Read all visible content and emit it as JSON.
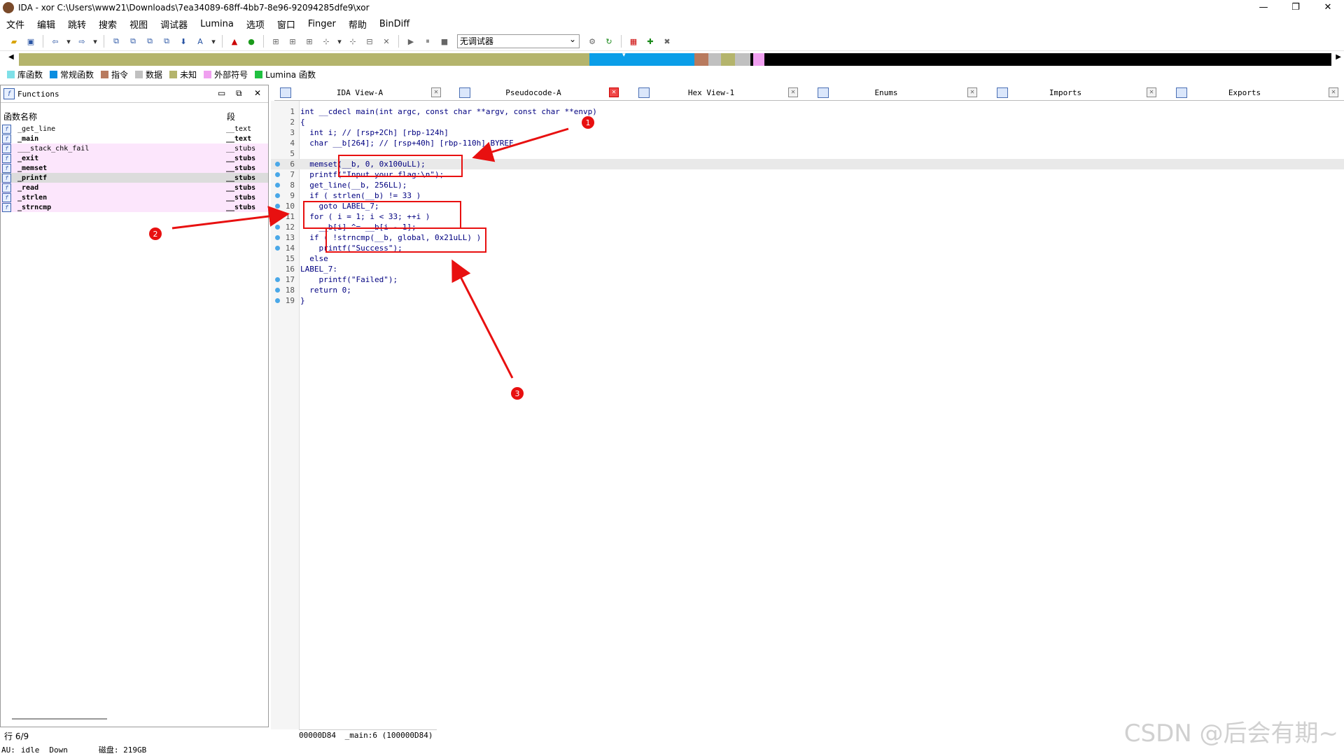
{
  "window": {
    "title": "IDA - xor C:\\Users\\www21\\Downloads\\7ea34089-68ff-4bb7-8e96-92094285dfe9\\xor",
    "controls": [
      "—",
      "❐",
      "✕"
    ]
  },
  "menu": [
    "文件",
    "编辑",
    "跳转",
    "搜索",
    "视图",
    "调试器",
    "Lumina",
    "选项",
    "窗口",
    "Finger",
    "帮助",
    "BinDiff"
  ],
  "toolbar": {
    "debugger_select": "无调试器"
  },
  "legend": [
    {
      "label": "库函数",
      "color": "#7fe0e8"
    },
    {
      "label": "常规函数",
      "color": "#0a8de0"
    },
    {
      "label": "指令",
      "color": "#b87a5e"
    },
    {
      "label": "数据",
      "color": "#c0c0c0"
    },
    {
      "label": "未知",
      "color": "#b4b46c"
    },
    {
      "label": "外部符号",
      "color": "#f0a0f0"
    },
    {
      "label": "Lumina 函数",
      "color": "#20c040"
    }
  ],
  "functions_panel": {
    "title": "Functions",
    "col_name": "函数名称",
    "col_segment": "段",
    "rows": [
      {
        "name": "_get_line",
        "segment": "__text",
        "bold": false,
        "pink": false
      },
      {
        "name": "_main",
        "segment": "__text",
        "bold": true,
        "pink": false
      },
      {
        "name": "___stack_chk_fail",
        "segment": "__stubs",
        "bold": false,
        "pink": true
      },
      {
        "name": "_exit",
        "segment": "__stubs",
        "bold": true,
        "pink": true
      },
      {
        "name": "_memset",
        "segment": "__stubs",
        "bold": true,
        "pink": true
      },
      {
        "name": "_printf",
        "segment": "__stubs",
        "bold": true,
        "pink": true,
        "selected": true
      },
      {
        "name": "_read",
        "segment": "__stubs",
        "bold": true,
        "pink": true
      },
      {
        "name": "_strlen",
        "segment": "__stubs",
        "bold": true,
        "pink": true
      },
      {
        "name": "_strncmp",
        "segment": "__stubs",
        "bold": true,
        "pink": true
      }
    ],
    "status": "行 6/9"
  },
  "tabs": [
    {
      "label": "IDA View-A",
      "active": false
    },
    {
      "label": "Pseudocode-A",
      "active": true
    },
    {
      "label": "Hex View-1",
      "active": false
    },
    {
      "label": "Enums",
      "active": false
    },
    {
      "label": "Imports",
      "active": false
    },
    {
      "label": "Exports",
      "active": false
    }
  ],
  "code": [
    {
      "n": "1",
      "dot": false,
      "t": "int __cdecl main(int argc, const char **argv, const char **envp)"
    },
    {
      "n": "2",
      "dot": false,
      "t": "{"
    },
    {
      "n": "3",
      "dot": false,
      "t": "  int i; // [rsp+2Ch] [rbp-124h]"
    },
    {
      "n": "4",
      "dot": false,
      "t": "  char __b[264]; // [rsp+40h] [rbp-110h] BYREF"
    },
    {
      "n": "5",
      "dot": false,
      "t": ""
    },
    {
      "n": "6",
      "dot": true,
      "t": "  memset(__b, 0, 0x100uLL);"
    },
    {
      "n": "7",
      "dot": true,
      "t": "  printf(\"Input your flag:\\n\");"
    },
    {
      "n": "8",
      "dot": true,
      "t": "  get_line(__b, 256LL);"
    },
    {
      "n": "9",
      "dot": true,
      "t": "  if ( strlen(__b) != 33 )"
    },
    {
      "n": "10",
      "dot": true,
      "t": "    goto LABEL_7;"
    },
    {
      "n": "11",
      "dot": true,
      "t": "  for ( i = 1; i < 33; ++i )"
    },
    {
      "n": "12",
      "dot": true,
      "t": "    __b[i] ^= __b[i - 1];"
    },
    {
      "n": "13",
      "dot": true,
      "t": "  if ( !strncmp(__b, global, 0x21uLL) )"
    },
    {
      "n": "14",
      "dot": true,
      "t": "    printf(\"Success\");"
    },
    {
      "n": "15",
      "dot": false,
      "t": "  else"
    },
    {
      "n": "16",
      "dot": false,
      "t": "LABEL_7:"
    },
    {
      "n": "17",
      "dot": true,
      "t": "    printf(\"Failed\");"
    },
    {
      "n": "18",
      "dot": true,
      "t": "  return 0;"
    },
    {
      "n": "19",
      "dot": true,
      "t": "}"
    }
  ],
  "address_bar": {
    "addr": "00000D84",
    "loc": "_main:6 (100000D84)"
  },
  "bottom_status": {
    "au": "AU:",
    "state": "idle",
    "dir": "Down",
    "disk": "磁盘: 219GB"
  },
  "annotations": [
    "1",
    "2",
    "3"
  ],
  "watermark": "CSDN @后会有期~"
}
